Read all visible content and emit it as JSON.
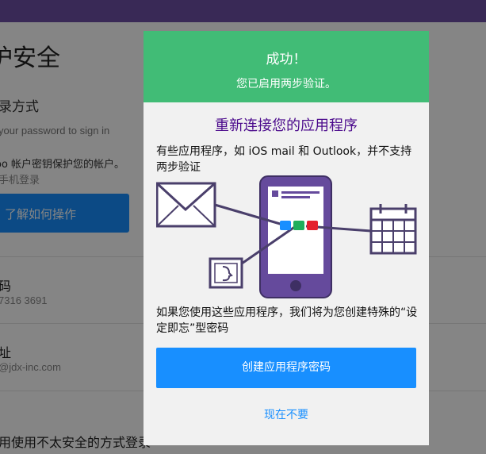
{
  "background": {
    "page_title": "护安全",
    "section_title": "录方式",
    "password_hint": "your password to sign in",
    "account_key_text": "oo 帐户密钥保护您的帐户。",
    "phone_login_link": "手机登录",
    "learn_button": "了解如何操作",
    "phone_label": "码",
    "phone_value": "7316 3691",
    "email_label": "址",
    "email_value": "@jdx-inc.com",
    "bottom_text": "用使用不太安全的方式登录"
  },
  "modal": {
    "title": "成功！",
    "subtitle": "您已启用两步验证。",
    "heading": "重新连接您的应用程序",
    "description": "有些应用程序，如 iOS mail 和 Outlook，并不支持两步验证",
    "note": "如果您使用这些应用程序，我们将为您创建特殊的“设定即忘”型密码",
    "primary_button": "创建应用程序密码",
    "secondary_link": "现在不要"
  },
  "colors": {
    "header_green": "#41bc76",
    "heading_purple": "#4b0a8c",
    "accent_blue": "#188fff",
    "topbar_purple": "#6e4fa6"
  },
  "icons": [
    "envelope-icon",
    "contact-card-icon",
    "phone-icon",
    "calendar-icon"
  ]
}
